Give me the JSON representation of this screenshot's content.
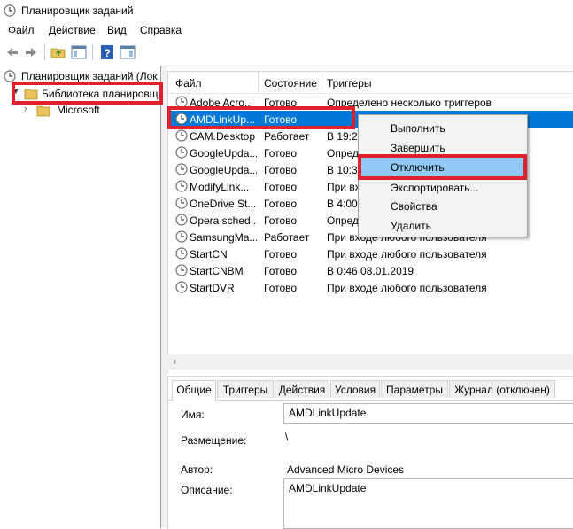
{
  "window": {
    "title": "Планировщик заданий"
  },
  "menu": [
    "Файл",
    "Действие",
    "Вид",
    "Справка"
  ],
  "toolbar": {
    "icons": [
      "back-arrow-icon",
      "forward-arrow-icon",
      "folder-up-icon",
      "show-pane-icon",
      "help-icon",
      "show-action-pane-icon"
    ]
  },
  "tree": {
    "root": "Планировщик заданий (Лок",
    "library": "Библиотека планировщ",
    "child": "Microsoft"
  },
  "task_list": {
    "columns": [
      "Файл",
      "Состояние",
      "Триггеры"
    ],
    "rows": [
      {
        "name": "Adobe Acro...",
        "status": "Готово",
        "trigger": "Определено несколько триггеров"
      },
      {
        "name": "AMDLinkUp...",
        "status": "Готово",
        "trigger": ""
      },
      {
        "name": "CAM.Desktop",
        "status": "Работает",
        "trigger": "В 19:21"
      },
      {
        "name": "GoogleUpda...",
        "status": "Готово",
        "trigger": "Опред"
      },
      {
        "name": "GoogleUpda...",
        "status": "Готово",
        "trigger": "В 10:38                                       после нача."
      },
      {
        "name": "ModifyLink...",
        "status": "Готово",
        "trigger": "При вх"
      },
      {
        "name": "OneDrive St...",
        "status": "Готово",
        "trigger": "В 4:00                                         начала: 1"
      },
      {
        "name": "Opera sched...",
        "status": "Готово",
        "trigger": "Опред"
      },
      {
        "name": "SamsungMa...",
        "status": "Работает",
        "trigger": "При входе любого пользователя"
      },
      {
        "name": "StartCN",
        "status": "Готово",
        "trigger": "При входе любого пользователя"
      },
      {
        "name": "StartCNBM",
        "status": "Готово",
        "trigger": "В 0:46 08.01.2019"
      },
      {
        "name": "StartDVR",
        "status": "Готово",
        "trigger": "При входе любого пользователя"
      }
    ],
    "selected_index": 1
  },
  "context_menu": {
    "items": [
      "Выполнить",
      "Завершить",
      "Отключить",
      "Экспортировать...",
      "Свойства",
      "Удалить"
    ],
    "hover_index": 2
  },
  "details": {
    "tabs": [
      "Общие",
      "Триггеры",
      "Действия",
      "Условия",
      "Параметры",
      "Журнал (отключен)"
    ],
    "active_tab": 0,
    "name_label": "Имя:",
    "name_value": "AMDLinkUpdate",
    "location_label": "Размещение:",
    "location_value": "\\",
    "author_label": "Автор:",
    "author_value": "Advanced Micro Devices",
    "description_label": "Описание:",
    "description_value": "AMDLinkUpdate"
  },
  "colors": {
    "selection": "#0078d7",
    "menu_hover": "#90c8f6",
    "highlight_box": "#e0202c"
  }
}
